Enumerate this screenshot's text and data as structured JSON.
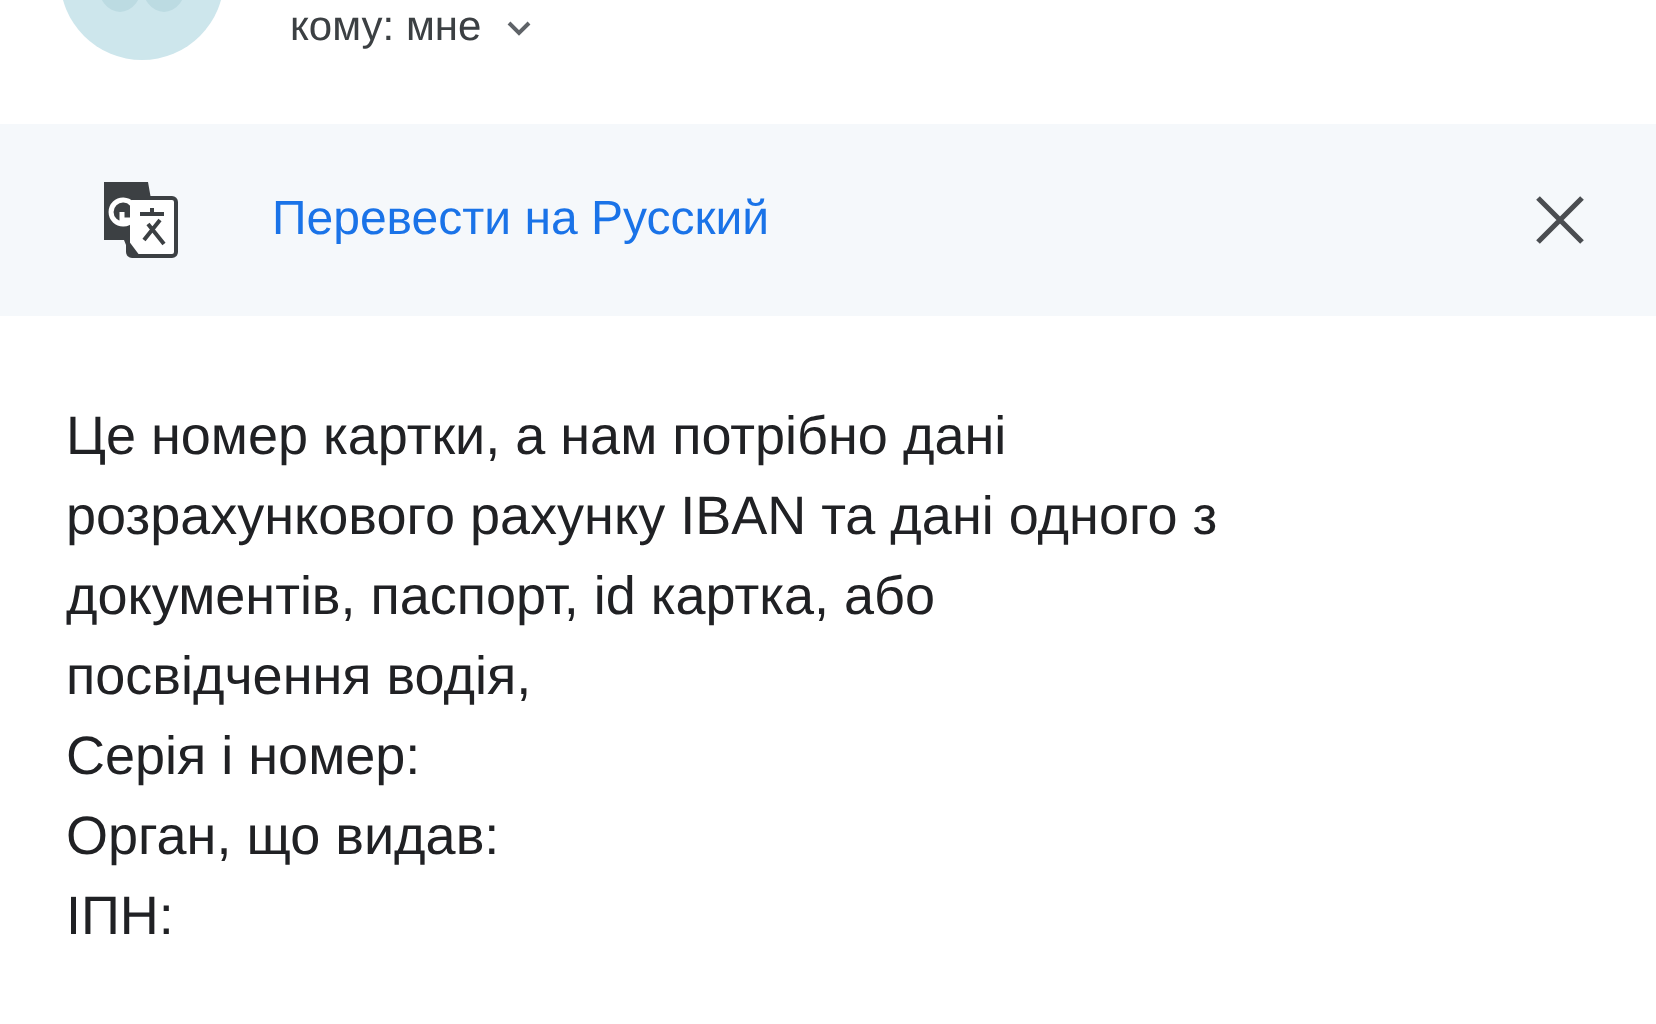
{
  "recipient": {
    "label": "кому: мне"
  },
  "translate_banner": {
    "link": "Перевести на Русский"
  },
  "message": {
    "lines": [
      "Це номер картки, а нам потрібно дані",
      "розрахункового рахунку IBAN та дані одного з",
      "документів, паспорт, id картка, або",
      "посвідчення водія,",
      "Серія і номер:",
      "Орган, що видав:",
      "ІПН:"
    ]
  }
}
